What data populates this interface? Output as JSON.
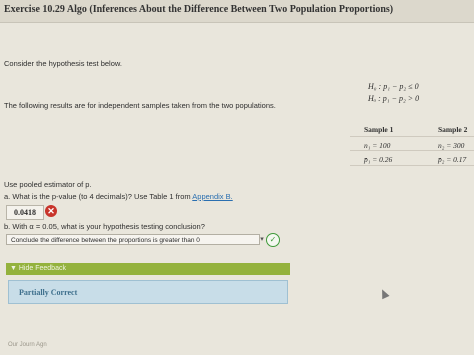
{
  "header": {
    "title": "Exercise 10.29 Algo (Inferences About the Difference Between Two Population Proportions)"
  },
  "intro": {
    "consider": "Consider the hypothesis test below.",
    "results": "The following results are for independent samples taken from the two populations."
  },
  "hypotheses": {
    "h0": "H₀ : p₁ − p₂ ≤ 0",
    "ha": "Hₐ : p₁ − p₂ > 0"
  },
  "table": {
    "headers": [
      "Sample 1",
      "Sample 2"
    ],
    "rows": [
      [
        "n₁ = 100",
        "n₂ = 300"
      ],
      [
        "p̄₁ = 0.26",
        "p̄₂ = 0.17"
      ]
    ]
  },
  "questions": {
    "instruction": "Use pooled estimator of p.",
    "a_prefix": "a. What is the p-value (to 4 decimals)? Use Table 1 from ",
    "a_link": "Appendix B.",
    "a_answer": "0.0418",
    "b_text": "b. With α = 0.05, what is your hypothesis testing conclusion?",
    "b_selected": "Conclude the difference between the proportions is greater than 0"
  },
  "feedback": {
    "toggle_label": "▼ Hide Feedback",
    "status": "Partially Correct"
  },
  "footer": {
    "text": "Our Journ Agn"
  },
  "colors": {
    "feedback_bar": "#94b23d",
    "feedback_box": "#c8dde8",
    "error": "#c8342b",
    "check": "#3f9a3a",
    "link": "#2a6fb0"
  },
  "icons": {
    "error": "x-circle-icon",
    "correct": "check-circle-icon",
    "dropdown": "chevron-down-icon",
    "cursor": "mouse-pointer-icon"
  }
}
